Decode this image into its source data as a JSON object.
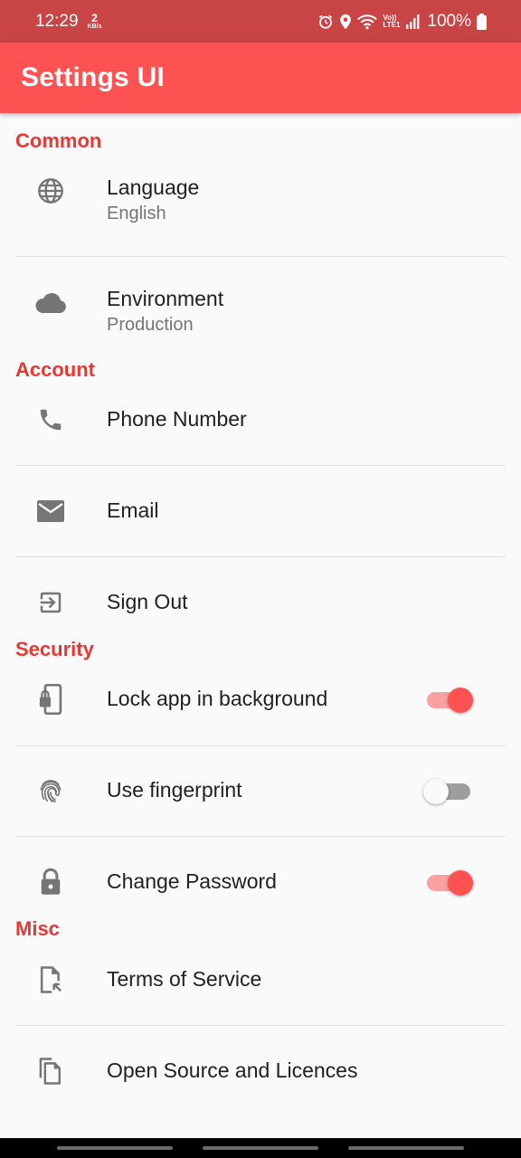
{
  "status_bar": {
    "time": "12:29",
    "net_speed_value": "2",
    "net_speed_unit": "KB/s",
    "lte_top": "Vo))",
    "lte_bottom": "LTE1",
    "battery": "100%"
  },
  "app_bar": {
    "title": "Settings UI"
  },
  "sections": {
    "common": {
      "title": "Common",
      "language": {
        "title": "Language",
        "value": "English",
        "icon": "globe-icon"
      },
      "environment": {
        "title": "Environment",
        "value": "Production",
        "icon": "cloud-icon"
      }
    },
    "account": {
      "title": "Account",
      "phone": {
        "title": "Phone Number",
        "icon": "phone-icon"
      },
      "email": {
        "title": "Email",
        "icon": "mail-icon"
      },
      "sign_out": {
        "title": "Sign Out",
        "icon": "exit-icon"
      }
    },
    "security": {
      "title": "Security",
      "lock_app": {
        "title": "Lock app in background",
        "icon": "phone-lock-icon",
        "enabled": true
      },
      "fingerprint": {
        "title": "Use fingerprint",
        "icon": "fingerprint-icon",
        "enabled": false
      },
      "change_password": {
        "title": "Change Password",
        "icon": "lock-icon",
        "enabled": true
      }
    },
    "misc": {
      "title": "Misc",
      "terms": {
        "title": "Terms of Service",
        "icon": "document-icon"
      },
      "licences": {
        "title": "Open Source and Licences",
        "icon": "copy-icon"
      }
    }
  },
  "colors": {
    "accent": "#fe5252",
    "status_bar": "#c94444",
    "section_title": "#e53935",
    "switch_track_on": "#f9a0a0",
    "switch_track_off": "#9e9e9e",
    "icon": "#757575"
  }
}
